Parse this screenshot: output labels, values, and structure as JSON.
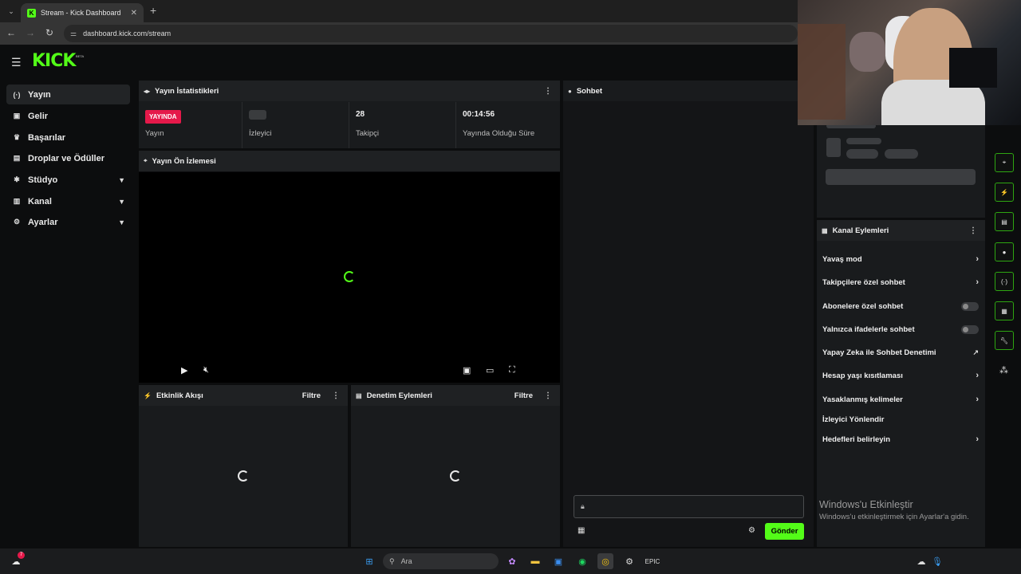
{
  "browser": {
    "tab_title": "Stream - Kick Dashboard",
    "tab_close": "✕",
    "new_tab": "+",
    "url": "dashboard.kick.com/stream"
  },
  "app": {
    "logo": "KICK",
    "logo_badge": "BETA",
    "accent": "#53fc18"
  },
  "sidebar": {
    "items": [
      {
        "label": "Yayın",
        "icon": "broadcast-icon",
        "glyph": "(·)",
        "active": true
      },
      {
        "label": "Gelir",
        "icon": "wallet-icon",
        "glyph": "▣"
      },
      {
        "label": "Başarılar",
        "icon": "trophy-icon",
        "glyph": "🏆"
      },
      {
        "label": "Droplar ve Ödüller",
        "icon": "gift-icon",
        "glyph": "▤"
      },
      {
        "label": "Stüdyo",
        "icon": "palette-icon",
        "glyph": "✱",
        "expandable": true
      },
      {
        "label": "Kanal",
        "icon": "channel-icon",
        "glyph": "▥",
        "expandable": true
      },
      {
        "label": "Ayarlar",
        "icon": "gear-icon",
        "glyph": "⚙",
        "expandable": true
      }
    ]
  },
  "stats": {
    "title": "Yayın İstatistikleri",
    "live_badge": "YAYINDA",
    "live_label": "Yayın",
    "viewers_label": "İzleyici",
    "followers_value": "28",
    "followers_label": "Takipçi",
    "uptime_value": "00:14:56",
    "uptime_label": "Yayında Olduğu Süre"
  },
  "preview": {
    "title": "Yayın Ön İzlemesi"
  },
  "activity": {
    "title": "Etkinlik Akışı",
    "filter": "Filtre"
  },
  "moderation": {
    "title": "Denetim Eylemleri",
    "filter": "Filtre"
  },
  "chat": {
    "title": "Sohbet",
    "send": "Gönder"
  },
  "channel_actions": {
    "title": "Kanal Eylemleri",
    "items": [
      {
        "label": "Yavaş mod",
        "control": "arrow"
      },
      {
        "label": "Takipçilere özel sohbet",
        "control": "arrow"
      },
      {
        "label": "Abonelere özel sohbet",
        "control": "toggle"
      },
      {
        "label": "Yalnızca ifadelerle sohbet",
        "control": "toggle"
      },
      {
        "label": "Yapay Zeka ile Sohbet Denetimi",
        "control": "external"
      },
      {
        "label": "Hesap yaşı kısıtlaması",
        "control": "arrow"
      },
      {
        "label": "Yasaklanmış kelimeler",
        "control": "arrow"
      },
      {
        "label": "İzleyici Yönlendir",
        "control": "none"
      },
      {
        "label": "Hedefleri belirleyin",
        "control": "arrow"
      }
    ]
  },
  "windows": {
    "activate_title": "Windows'u Etkinleştir",
    "activate_sub": "Windows'u etkinleştirmek için Ayarlar'a gidin.",
    "search_placeholder": "Ara",
    "weather_badge": "7"
  }
}
